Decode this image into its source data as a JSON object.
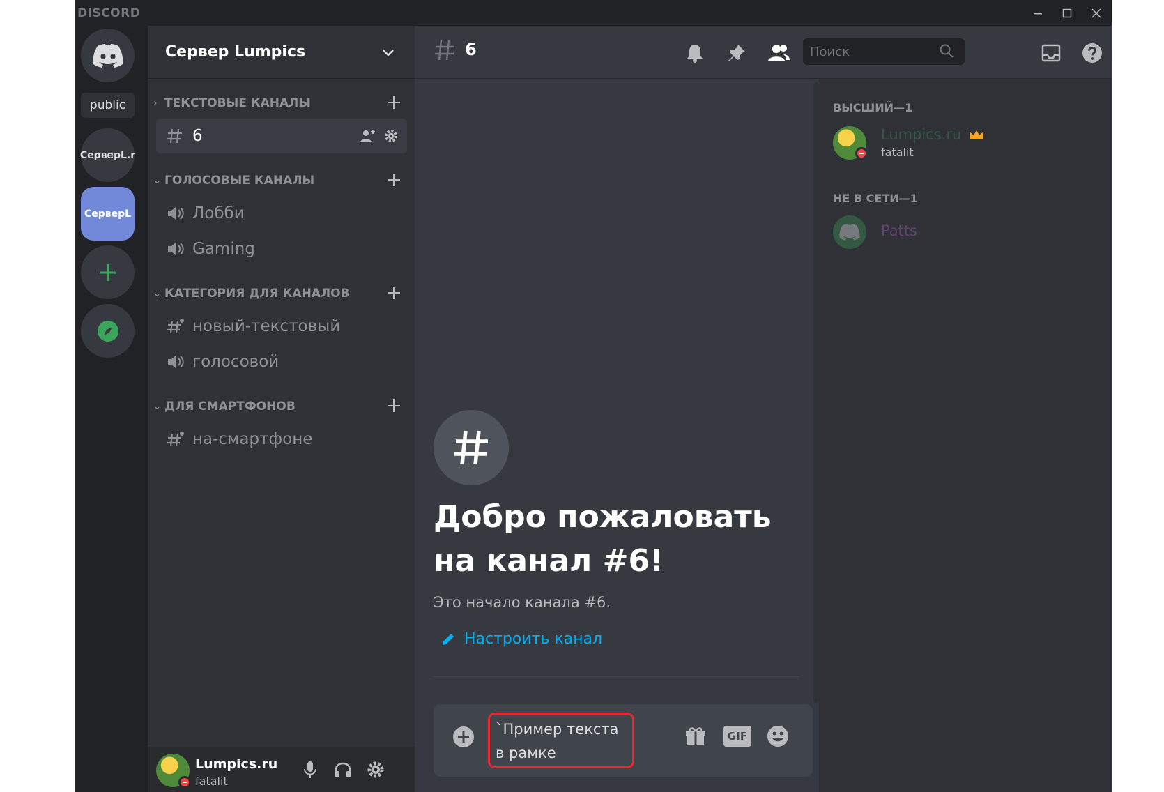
{
  "app": {
    "brand": "DISCORD"
  },
  "rail": {
    "public_label": "public",
    "servers": [
      {
        "label": "СерверL.r"
      },
      {
        "label": "СерверL"
      }
    ]
  },
  "sidebar": {
    "server_name": "Сервер Lumpics",
    "categories": [
      {
        "name": "ТЕКСТОВЫЕ КАНАЛЫ"
      },
      {
        "name": "ГОЛОСОВЫЕ КАНАЛЫ"
      },
      {
        "name": "КАТЕГОРИЯ ДЛЯ КАНАЛОВ"
      },
      {
        "name": "ДЛЯ СМАРТФОНОВ"
      }
    ],
    "channels": [
      {
        "name": "6"
      },
      {
        "name": "Лобби"
      },
      {
        "name": "Gaming"
      },
      {
        "name": "новый-текстовый"
      },
      {
        "name": "голосовой"
      },
      {
        "name": "на-смартфоне"
      }
    ]
  },
  "user": {
    "name": "Lumpics.ru",
    "tag": "fatalit"
  },
  "header": {
    "channel": "6",
    "search_placeholder": "Поиск"
  },
  "main": {
    "welcome_title": "Добро пожаловать на канал #6!",
    "welcome_sub": "Это начало канала #6.",
    "edit_link": "Настроить канал"
  },
  "composer": {
    "text": "`Пример текста в рамке",
    "gif_label": "GIF"
  },
  "members": {
    "online_header": "ВЫСШИЙ—1",
    "offline_header": "НЕ В СЕТИ—1",
    "online": [
      {
        "name": "Lumpics.ru",
        "sub": "fatalit"
      }
    ],
    "offline": [
      {
        "name": "Patts"
      }
    ]
  },
  "colors": {
    "accent": "#7289da",
    "link": "#00b0f4",
    "green": "#3ba55c",
    "highlight": "#e8272f"
  }
}
